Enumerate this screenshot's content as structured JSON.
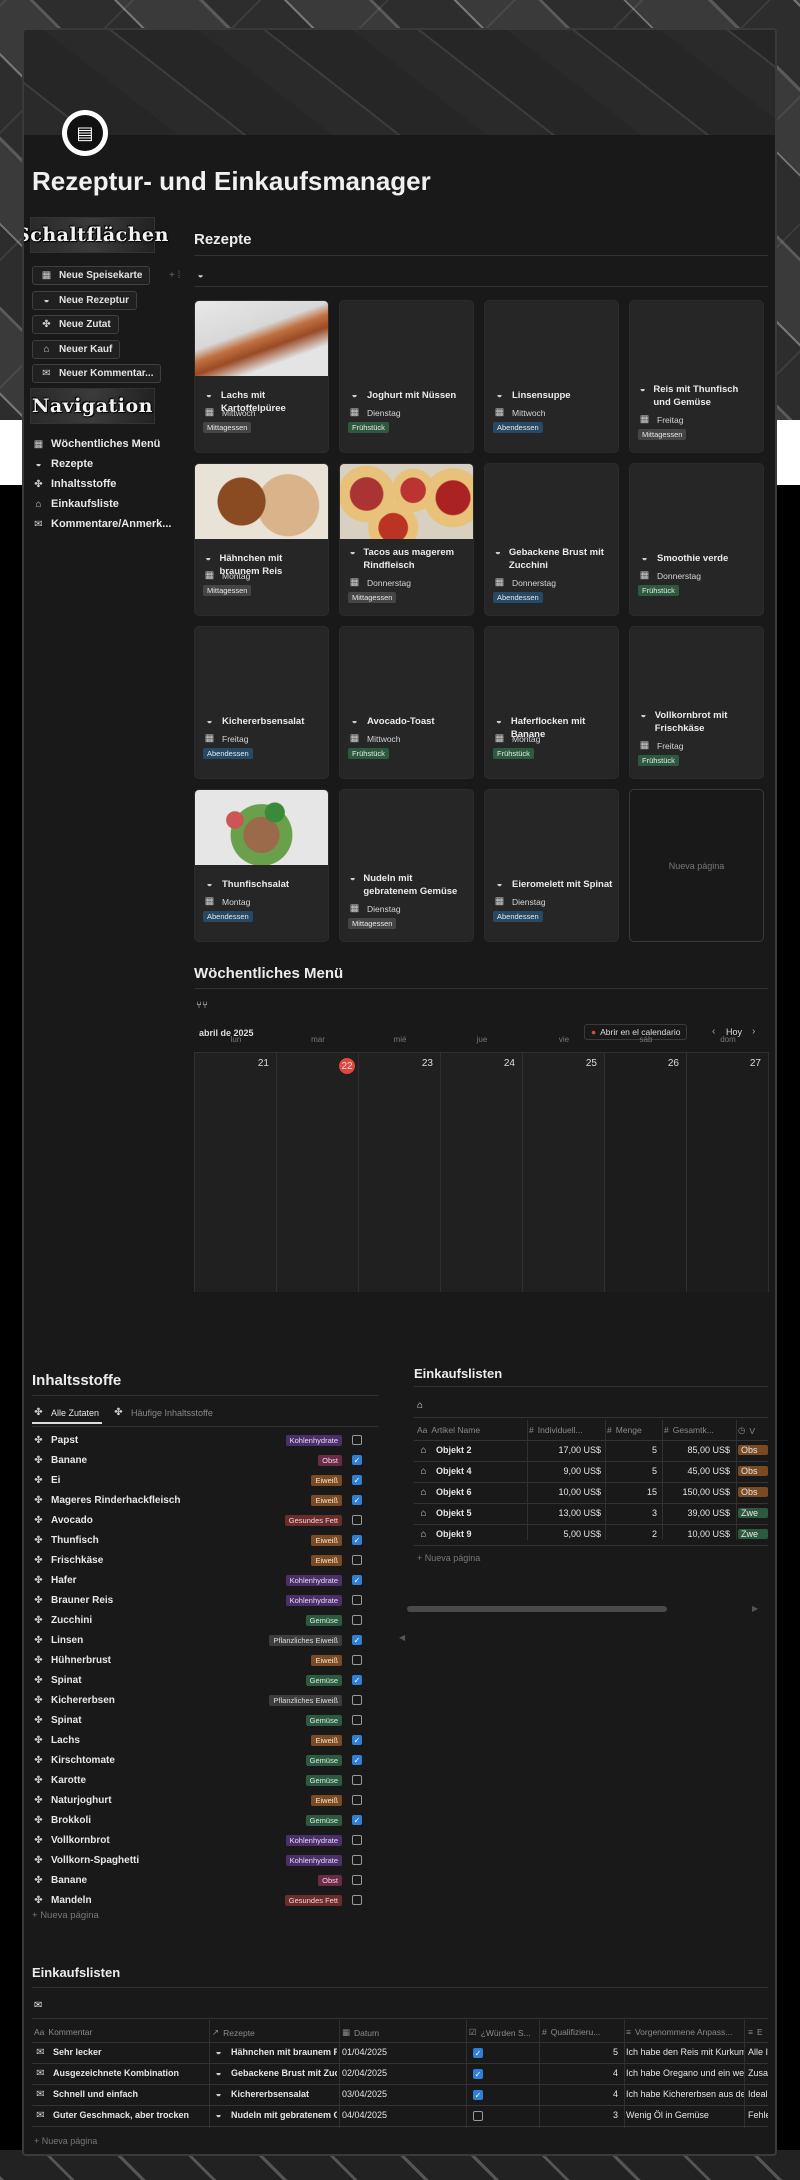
{
  "title": "Rezeptur- und Einkaufsmanager",
  "sidebar": {
    "head1": "Schaltflächen",
    "buttons": [
      "Neue Speisekarte",
      "Neue Rezeptur",
      "Neue Zutat",
      "Neuer Kauf",
      "Neuer Kommentar..."
    ],
    "head2": "Navigation",
    "nav": [
      "Wöchentliches Menü",
      "Rezepte",
      "Inhaltsstoffe",
      "Einkaufsliste",
      "Kommentare/Anmerk..."
    ]
  },
  "recipes": {
    "title": "Rezepte",
    "cards": [
      {
        "t": "Lachs mit Kartoffelpüree",
        "d": "Mittwoch",
        "g": "Mittagessen"
      },
      {
        "t": "Joghurt mit Nüssen",
        "d": "Dienstag",
        "g": "Frühstück"
      },
      {
        "t": "Linsensuppe",
        "d": "Mittwoch",
        "g": "Abendessen"
      },
      {
        "t": "Reis mit Thunfisch und Gemüse",
        "d": "Freitag",
        "g": "Mittagessen"
      },
      {
        "t": "Hähnchen mit braunem Reis",
        "d": "Montag",
        "g": "Mittagessen"
      },
      {
        "t": "Tacos aus magerem Rindfleisch",
        "d": "Donnerstag",
        "g": "Mittagessen"
      },
      {
        "t": "Gebackene Brust mit Zucchini",
        "d": "Donnerstag",
        "g": "Abendessen"
      },
      {
        "t": "Smoothie verde",
        "d": "Donnerstag",
        "g": "Frühstück"
      },
      {
        "t": "Kichererbsensalat",
        "d": "Freitag",
        "g": "Abendessen"
      },
      {
        "t": "Avocado-Toast",
        "d": "Mittwoch",
        "g": "Frühstück"
      },
      {
        "t": "Haferflocken mit Banane",
        "d": "Montag",
        "g": "Frühstück"
      },
      {
        "t": "Vollkornbrot mit Frischkäse",
        "d": "Freitag",
        "g": "Frühstück"
      },
      {
        "t": "Thunfischsalat",
        "d": "Montag",
        "g": "Abendessen"
      },
      {
        "t": "Nudeln mit gebratenem Gemüse",
        "d": "Dienstag",
        "g": "Mittagessen"
      },
      {
        "t": "Eieromelett mit Spinat",
        "d": "Dienstag",
        "g": "Abendessen"
      }
    ],
    "new_page": "Nueva página"
  },
  "menu": {
    "title": "Wöchentliches Menü",
    "month": "abril de 2025",
    "open_cal": "Abrir en el calendario",
    "today": "Hoy",
    "days": [
      "lun",
      "mar",
      "mié",
      "jue",
      "vie",
      "sáb",
      "dom"
    ],
    "dates": [
      "21",
      "22",
      "23",
      "24",
      "25",
      "26",
      "27"
    ]
  },
  "ingredients": {
    "title": "Inhaltsstoffe",
    "tab1": "Alle Zutaten",
    "tab2": "Häufige Inhaltsstoffe",
    "rows": [
      {
        "n": "Papst",
        "t": "Kohlenhydrate",
        "c": false
      },
      {
        "n": "Banane",
        "t": "Obst",
        "c": true
      },
      {
        "n": "Ei",
        "t": "Eiweiß",
        "c": true
      },
      {
        "n": "Mageres Rinderhackfleisch",
        "t": "Eiweiß",
        "c": true
      },
      {
        "n": "Avocado",
        "t": "Gesundes Fett",
        "c": false
      },
      {
        "n": "Thunfisch",
        "t": "Eiweiß",
        "c": true
      },
      {
        "n": "Frischkäse",
        "t": "Eiweiß",
        "c": false
      },
      {
        "n": "Hafer",
        "t": "Kohlenhydrate",
        "c": true
      },
      {
        "n": "Brauner Reis",
        "t": "Kohlenhydrate",
        "c": false
      },
      {
        "n": "Zucchini",
        "t": "Gemüse",
        "c": false
      },
      {
        "n": "Linsen",
        "t": "Pflanzliches Eiweiß",
        "c": true
      },
      {
        "n": "Hühnerbrust",
        "t": "Eiweiß",
        "c": false
      },
      {
        "n": "Spinat",
        "t": "Gemüse",
        "c": true
      },
      {
        "n": "Kichererbsen",
        "t": "Pflanzliches Eiweiß",
        "c": false
      },
      {
        "n": "Spinat",
        "t": "Gemüse",
        "c": false
      },
      {
        "n": "Lachs",
        "t": "Eiweiß",
        "c": true
      },
      {
        "n": "Kirschtomate",
        "t": "Gemüse",
        "c": true
      },
      {
        "n": "Karotte",
        "t": "Gemüse",
        "c": false
      },
      {
        "n": "Naturjoghurt",
        "t": "Eiweiß",
        "c": false
      },
      {
        "n": "Brokkoli",
        "t": "Gemüse",
        "c": true
      },
      {
        "n": "Vollkornbrot",
        "t": "Kohlenhydrate",
        "c": false
      },
      {
        "n": "Vollkorn-Spaghetti",
        "t": "Kohlenhydrate",
        "c": false
      },
      {
        "n": "Banane",
        "t": "Obst",
        "c": false
      },
      {
        "n": "Mandeln",
        "t": "Gesundes Fett",
        "c": false
      }
    ],
    "new_page": "Nueva página"
  },
  "shopping": {
    "title": "Einkaufslisten",
    "cols": [
      "Artikel Name",
      "Individuell...",
      "Menge",
      "Gesamtk...",
      "V"
    ],
    "rows": [
      {
        "n": "Objekt 2",
        "p": "17,00 US$",
        "m": "5",
        "g": "85,00 US$",
        "v": "Obs"
      },
      {
        "n": "Objekt 4",
        "p": "9,00 US$",
        "m": "5",
        "g": "45,00 US$",
        "v": "Obs"
      },
      {
        "n": "Objekt 6",
        "p": "10,00 US$",
        "m": "15",
        "g": "150,00 US$",
        "v": "Obs"
      },
      {
        "n": "Objekt 5",
        "p": "13,00 US$",
        "m": "3",
        "g": "39,00 US$",
        "v": "Zwe"
      },
      {
        "n": "Objekt 9",
        "p": "5,00 US$",
        "m": "2",
        "g": "10,00 US$",
        "v": "Zwe"
      }
    ],
    "new_page": "Nueva página"
  },
  "comments": {
    "title": "Einkaufslisten",
    "cols": [
      "Kommentar",
      "Rezepte",
      "Datum",
      "¿Würden S...",
      "Qualifizieru...",
      "Vorgenommene Anpass...",
      "E"
    ],
    "rows": [
      {
        "k": "Sehr lecker",
        "r": "Hähnchen mit braunem Re",
        "d": "01/04/2025",
        "w": true,
        "q": "5",
        "a": "Ich habe den Reis mit Kurkuma",
        "e": "Alle I"
      },
      {
        "k": "Ausgezeichnete Kombination",
        "r": "Gebackene Brust mit Zucc",
        "d": "02/04/2025",
        "w": true,
        "q": "4",
        "a": "Ich habe Oregano und ein wenig",
        "e": "Zusa"
      },
      {
        "k": "Schnell und einfach",
        "r": "Kichererbsensalat",
        "d": "03/04/2025",
        "w": true,
        "q": "4",
        "a": "Ich habe Kichererbsen aus der D",
        "e": "Ideal"
      },
      {
        "k": "Guter Geschmack, aber trocken",
        "r": "Nudeln mit gebratenem Ge",
        "d": "04/04/2025",
        "w": false,
        "q": "3",
        "a": "Wenig Öl in Gemüse",
        "e": "Fehle"
      }
    ],
    "new_page": "Nueva página"
  }
}
